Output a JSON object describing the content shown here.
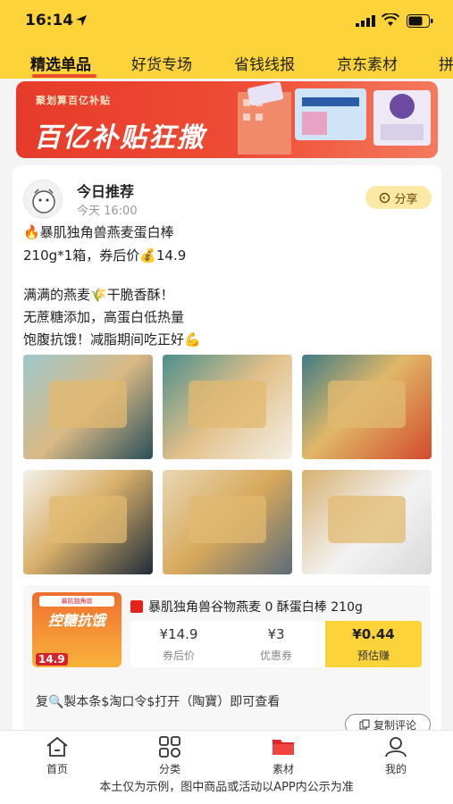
{
  "status_bar": {
    "time": "16:14"
  },
  "tabs": [
    {
      "label": "精选单品",
      "active": true
    },
    {
      "label": "好货专场",
      "active": false
    },
    {
      "label": "省钱线报",
      "active": false
    },
    {
      "label": "京东素材",
      "active": false
    },
    {
      "label": "拼",
      "active": false
    }
  ],
  "banner": {
    "small_text": "聚划算百亿补贴",
    "big_text": "百亿补贴狂撒"
  },
  "feed": {
    "title": "今日推荐",
    "time": "今天 16:00",
    "share_label": "分享",
    "lines": [
      "🔥暴肌独角兽燕麦蛋白棒",
      "210g*1箱，券后价💰14.9",
      "",
      "满满的燕麦🌾干脆香酥！",
      "无蔗糖添加，高蛋白低热量",
      "饱腹抗饿！减脂期间吃正好💪"
    ],
    "photos": [
      "photo-1",
      "photo-2",
      "photo-3",
      "photo-4",
      "photo-5",
      "photo-6"
    ]
  },
  "product": {
    "thumb_top": "暴肌独角兽",
    "thumb_title": "控糖抗饿",
    "thumb_price": "14.9",
    "name": "暴肌独角兽谷物燕麦 0 酥蛋白棒 210g",
    "price_after_coupon": "¥14.9",
    "price_after_coupon_label": "券后价",
    "coupon": "¥3",
    "coupon_label": "优惠券",
    "estimated": "¥0.44",
    "estimated_label": "预估赚"
  },
  "copy": {
    "text": "复🔍製本条$淘口令$打开（陶寶）即可查看",
    "button": "复制评论"
  },
  "nav": [
    {
      "label": "首页",
      "icon": "home-icon"
    },
    {
      "label": "分类",
      "icon": "category-icon"
    },
    {
      "label": "素材",
      "icon": "folder-icon",
      "active": true
    },
    {
      "label": "我的",
      "icon": "profile-icon"
    }
  ],
  "disclaimer": "本土仅为示例，图中商品或活动以APP内公示为准",
  "colors": {
    "accent_yellow": "#fcd43a",
    "accent_red": "#e94b2b"
  }
}
